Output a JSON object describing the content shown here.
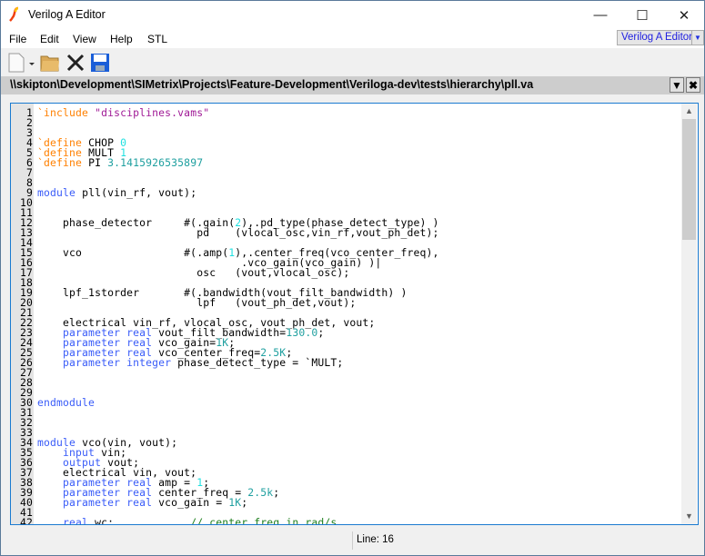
{
  "window": {
    "title": "Verilog A Editor",
    "minimize": "—",
    "maximize": "☐",
    "close": "✕"
  },
  "menu": [
    "File",
    "Edit",
    "View",
    "Help",
    "STL"
  ],
  "mode_selector": {
    "value": "Verilog A Editor"
  },
  "toolbar": {
    "icons": [
      "new-file-icon",
      "dropdown-icon",
      "open-folder-icon",
      "close-icon",
      "save-icon"
    ]
  },
  "file_path": "\\\\skipton\\Development\\SIMetrix\\Projects\\Feature-Development\\Veriloga-dev\\tests\\hierarchy\\pll.va",
  "colors": {
    "keyword": "#3a5cf8",
    "directive": "#ff8000",
    "string": "#a01a96",
    "number": "#1fe0e0",
    "comment": "#208020",
    "border": "#1a7ad0"
  },
  "code_lines": [
    [
      [
        "dir",
        "`include "
      ],
      [
        "str",
        "\"disciplines.vams\""
      ]
    ],
    [],
    [],
    [
      [
        "dir",
        "`define "
      ],
      [
        "t",
        "CHOP "
      ],
      [
        "num",
        "0"
      ]
    ],
    [
      [
        "dir",
        "`define "
      ],
      [
        "t",
        "MULT "
      ],
      [
        "num",
        "1"
      ]
    ],
    [
      [
        "dir",
        "`define "
      ],
      [
        "t",
        "PI "
      ],
      [
        "num2",
        "3.1415926535897"
      ]
    ],
    [],
    [],
    [
      [
        "kw",
        "module "
      ],
      [
        "t",
        "pll(vin_rf, vout);"
      ]
    ],
    [],
    [],
    [
      [
        "t",
        "    phase_detector     #(.gain("
      ],
      [
        "num",
        "2"
      ],
      [
        "t",
        "),.pd_type(phase_detect_type) )"
      ]
    ],
    [
      [
        "t",
        "                         pd    (vlocal_osc,vin_rf,vout_ph_det);"
      ]
    ],
    [],
    [
      [
        "t",
        "    vco                #(.amp("
      ],
      [
        "num",
        "1"
      ],
      [
        "t",
        "),.center_freq(vco_center_freq),"
      ]
    ],
    [
      [
        "t",
        "                                .vco_gain(vco_gain) )|"
      ]
    ],
    [
      [
        "t",
        "                         osc   (vout,vlocal_osc);"
      ]
    ],
    [],
    [
      [
        "t",
        "    lpf_1storder       #(.bandwidth(vout_filt_bandwidth) )"
      ]
    ],
    [
      [
        "t",
        "                         lpf   (vout_ph_det,vout);"
      ]
    ],
    [],
    [
      [
        "t",
        "    electrical vin_rf, vlocal_osc, vout_ph_det, vout;"
      ]
    ],
    [
      [
        "kw",
        "    parameter real "
      ],
      [
        "t",
        "vout_filt_bandwidth="
      ],
      [
        "num2",
        "130.0"
      ],
      [
        "t",
        ";"
      ]
    ],
    [
      [
        "kw",
        "    parameter real "
      ],
      [
        "t",
        "vco_gain="
      ],
      [
        "num2",
        "1K"
      ],
      [
        "t",
        ";"
      ]
    ],
    [
      [
        "kw",
        "    parameter real "
      ],
      [
        "t",
        "vco_center_freq="
      ],
      [
        "num2",
        "2.5K"
      ],
      [
        "t",
        ";"
      ]
    ],
    [
      [
        "kw",
        "    parameter integer "
      ],
      [
        "t",
        "phase_detect_type = `MULT;"
      ]
    ],
    [],
    [],
    [],
    [
      [
        "kw",
        "endmodule"
      ]
    ],
    [],
    [],
    [],
    [
      [
        "kw",
        "module "
      ],
      [
        "t",
        "vco(vin, vout);"
      ]
    ],
    [
      [
        "kw",
        "    input "
      ],
      [
        "t",
        "vin;"
      ]
    ],
    [
      [
        "kw",
        "    output "
      ],
      [
        "t",
        "vout;"
      ]
    ],
    [
      [
        "t",
        "    electrical vin, vout;"
      ]
    ],
    [
      [
        "kw",
        "    parameter real "
      ],
      [
        "t",
        "amp = "
      ],
      [
        "num",
        "1"
      ],
      [
        "t",
        ";"
      ]
    ],
    [
      [
        "kw",
        "    parameter real "
      ],
      [
        "t",
        "center_freq = "
      ],
      [
        "num2",
        "2.5k"
      ],
      [
        "t",
        ";"
      ]
    ],
    [
      [
        "kw",
        "    parameter real "
      ],
      [
        "t",
        "vco_gain = "
      ],
      [
        "num2",
        "1K"
      ],
      [
        "t",
        ";"
      ]
    ],
    [],
    [
      [
        "kw",
        "    real "
      ],
      [
        "t",
        "wc;            "
      ],
      [
        "cm",
        "// center freq in rad/s"
      ]
    ]
  ],
  "status": {
    "line": "Line: 16"
  }
}
